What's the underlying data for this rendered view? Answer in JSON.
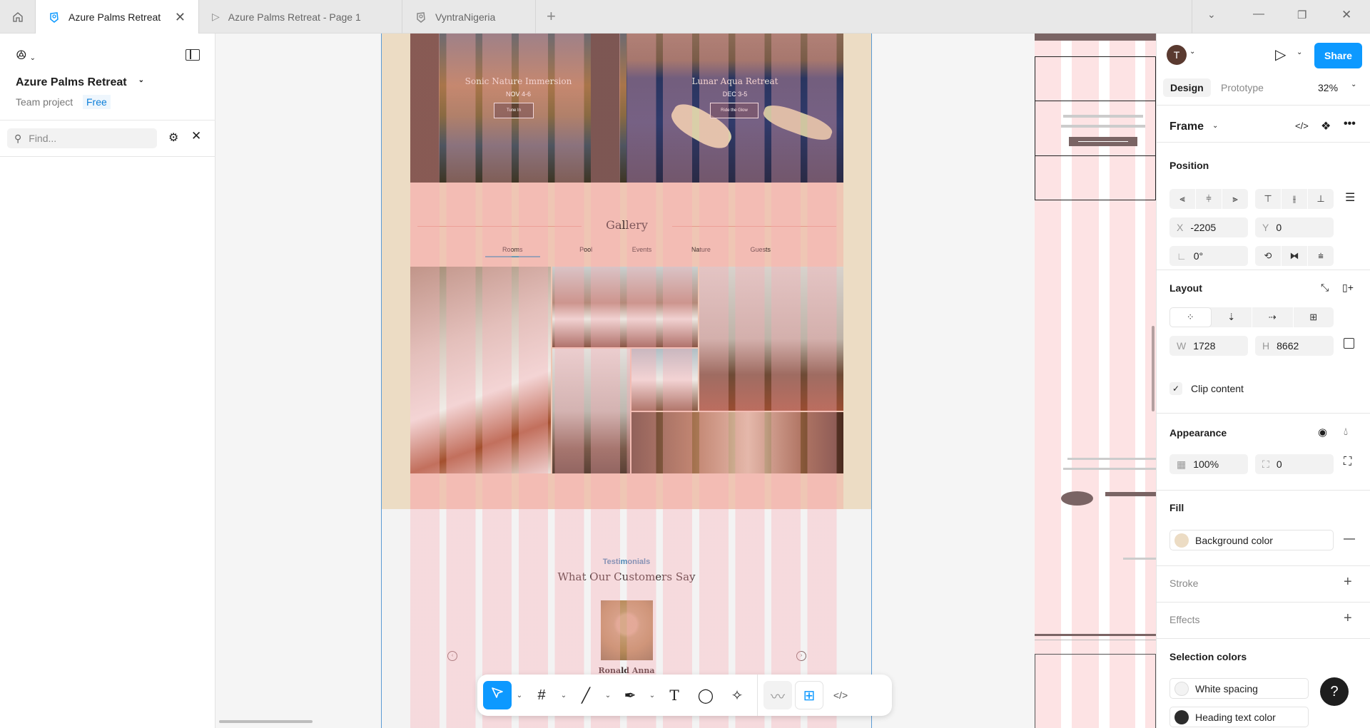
{
  "tabs": [
    {
      "label": "Azure Palms Retreat",
      "active": true
    },
    {
      "label": "Azure Palms Retreat - Page 1"
    },
    {
      "label": "VyntraNigeria"
    }
  ],
  "left_panel": {
    "file_title": "Azure Palms Retreat",
    "team": "Team project",
    "plan": "Free",
    "search_placeholder": "Find..."
  },
  "canvas": {
    "events": [
      {
        "title": "Sonic Nature Immersion",
        "date": "NOV 4-6",
        "button": "Tune In"
      },
      {
        "title": "Lunar Aqua Retreat",
        "date": "DEC 3-5",
        "button": "Ride the Glow"
      }
    ],
    "gallery": {
      "title": "Gallery",
      "tabs": [
        "Rooms",
        "Pool",
        "Events",
        "Nature",
        "Guests"
      ],
      "active_tab": "Rooms"
    },
    "testimonials": {
      "eyebrow": "Testimonials",
      "heading": "What Our Customers Say",
      "name": "Ronald Anna"
    }
  },
  "right_panel": {
    "avatar_initial": "T",
    "share": "Share",
    "tabs": [
      "Design",
      "Prototype"
    ],
    "zoom": "32%",
    "selection_type": "Frame",
    "position": {
      "title": "Position",
      "x_label": "X",
      "x": "-2205",
      "y_label": "Y",
      "y": "0",
      "rotation": "0°"
    },
    "layout": {
      "title": "Layout",
      "w_label": "W",
      "w": "1728",
      "h_label": "H",
      "h": "8662",
      "clip_label": "Clip content",
      "clip": true
    },
    "appearance": {
      "title": "Appearance",
      "opacity": "100%",
      "radius": "0"
    },
    "fill": {
      "title": "Fill",
      "label": "Background color",
      "color": "#ecdcc4"
    },
    "stroke": "Stroke",
    "effects": "Effects",
    "selection_colors": {
      "title": "Selection colors",
      "items": [
        {
          "label": "White spacing",
          "color": "#f3f3f3"
        },
        {
          "label": "Heading text color",
          "color": "#2c2c2c"
        }
      ]
    }
  },
  "colors": {
    "accent": "#0d99ff",
    "frame_bg": "#ecdcc4",
    "gallery_bg": "#efc6b4"
  }
}
